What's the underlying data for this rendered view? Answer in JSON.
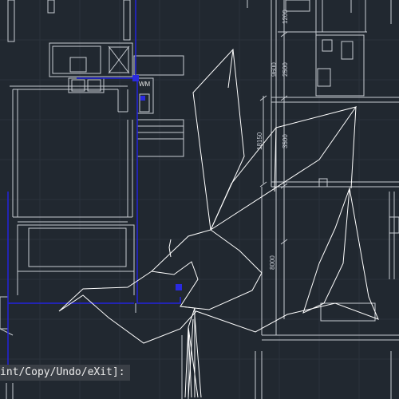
{
  "drawing": {
    "dimensions": [
      {
        "id": "dim-1200",
        "text": "1200"
      },
      {
        "id": "dim-9600",
        "text": "9600"
      },
      {
        "id": "dim-2500",
        "text": "2500"
      },
      {
        "id": "dim-18150",
        "text": "18150"
      },
      {
        "id": "dim-3500",
        "text": "3500"
      },
      {
        "id": "dim-8000",
        "text": "8000"
      }
    ],
    "fixture_labels": {
      "washing_machine": "WM"
    }
  },
  "command_line": {
    "text": "int/Copy/Undo/eXit]:"
  },
  "colors": {
    "background": "#212830",
    "walls": "#c8ccd2",
    "highlight": "#2222dd",
    "sketch": "#ffffff",
    "grip": "#2a2ae0"
  }
}
